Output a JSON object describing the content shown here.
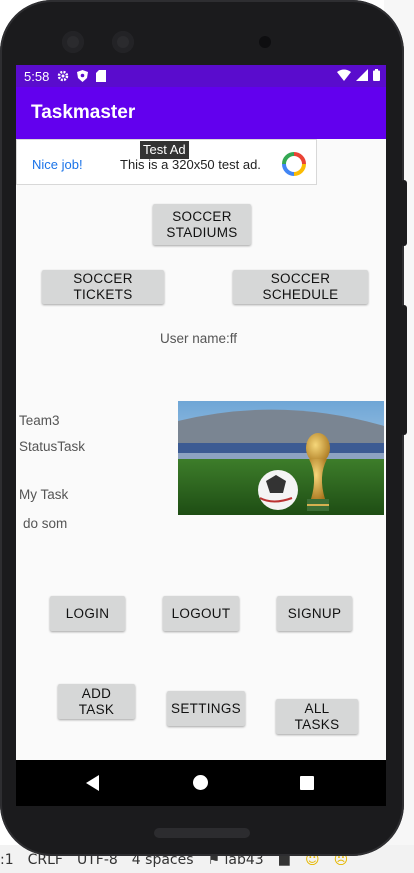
{
  "ide": {
    "status_items": [
      ":1",
      "CRLF",
      "UTF-8",
      "4 spaces",
      "lab43"
    ]
  },
  "status_bar": {
    "time": "5:58",
    "icons_left": [
      "gear-icon",
      "shield-icon",
      "sd-card-icon"
    ],
    "icons_right": [
      "wifi-icon",
      "signal-icon",
      "battery-icon"
    ]
  },
  "app_bar": {
    "title": "Taskmaster",
    "color": "#6200ee"
  },
  "ad": {
    "tag": "Test Ad",
    "left_text": "Nice job!",
    "message": "This is a 320x50 test ad."
  },
  "buttons": {
    "stadiums": "SOCCER STADIUMS",
    "tickets": "SOCCER TICKETS",
    "schedule": "SOCCER SCHEDULE",
    "login": "LOGIN",
    "logout": "LOGOUT",
    "signup": "SIGNUP",
    "add_task": "ADD TASK",
    "settings": "SETTINGS",
    "all_tasks": "ALL TASKS"
  },
  "user": {
    "label": "User name:ff"
  },
  "task": {
    "team": "Team3",
    "status": "StatusTask",
    "my_task": "My Task",
    "body": "do som"
  },
  "image": {
    "alt": "soccer-ball-and-trophy-image"
  }
}
